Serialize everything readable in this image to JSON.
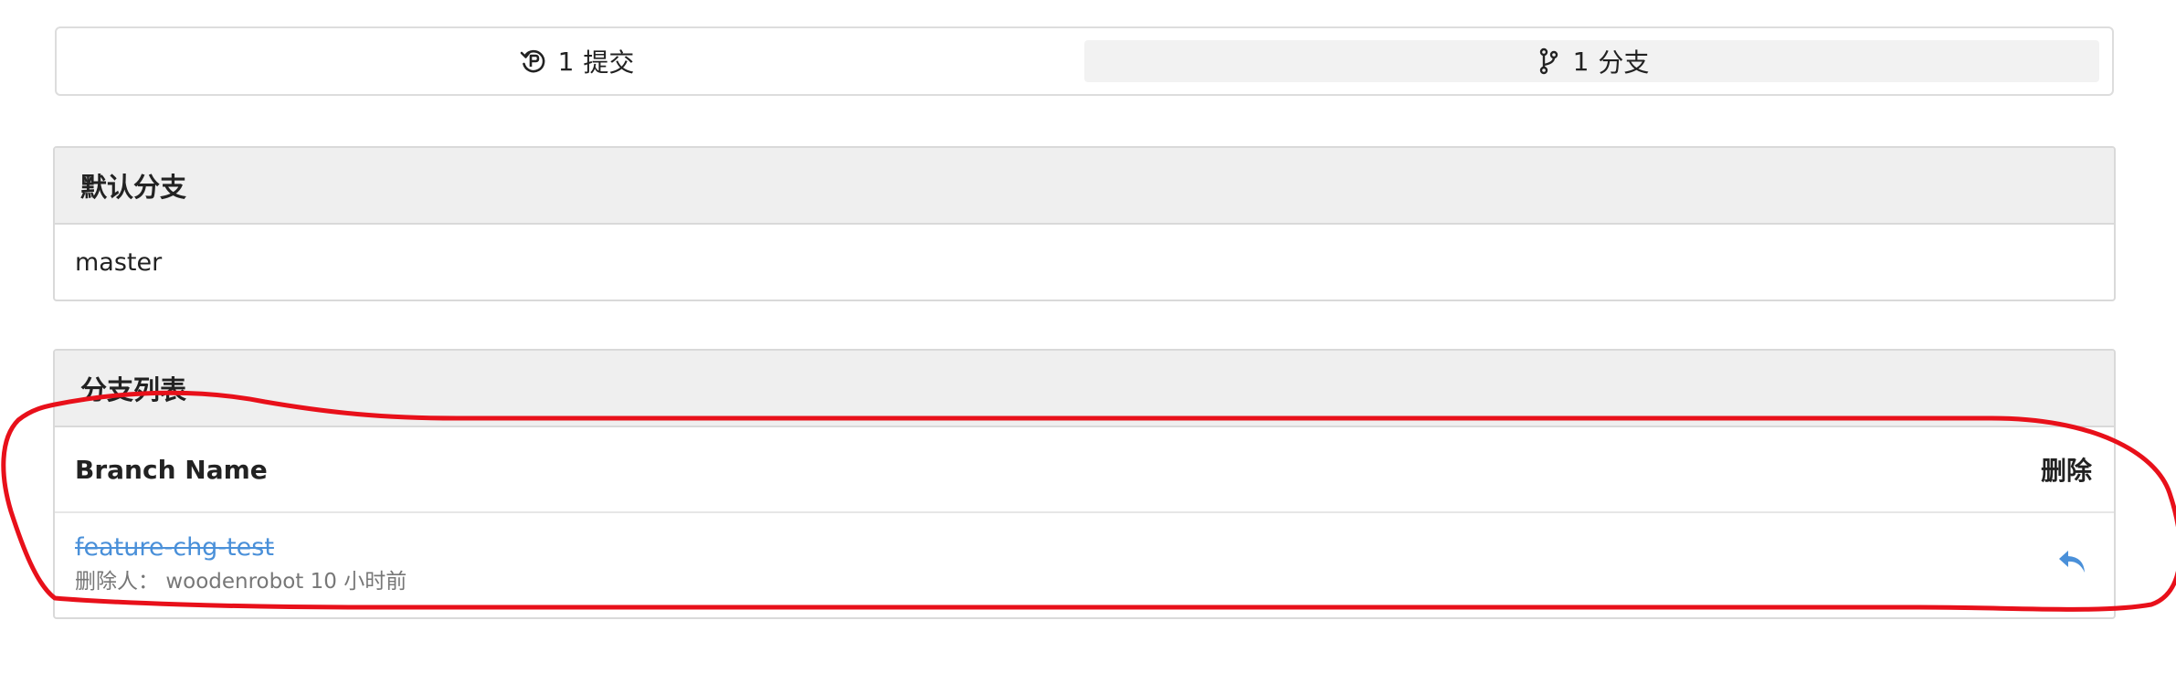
{
  "stats": {
    "commits": {
      "count": "1",
      "label": "提交",
      "icon": "history-icon"
    },
    "branches": {
      "count": "1",
      "label": "分支",
      "icon": "branch-icon"
    }
  },
  "default_branch": {
    "heading": "默认分支",
    "value": "master"
  },
  "branch_list": {
    "heading": "分支列表",
    "columns": {
      "name": "Branch Name",
      "delete": "删除"
    },
    "rows": [
      {
        "name": "feature-chg-test",
        "meta_prefix": "删除人：",
        "meta_user": "woodenrobot",
        "meta_time": "10 小时前",
        "action_icon": "restore-icon"
      }
    ]
  },
  "colors": {
    "link": "#4a90d9",
    "annotation": "#e8101a",
    "active_tab_bg": "#f2f2f2",
    "panel_heading_bg": "#efefef"
  }
}
